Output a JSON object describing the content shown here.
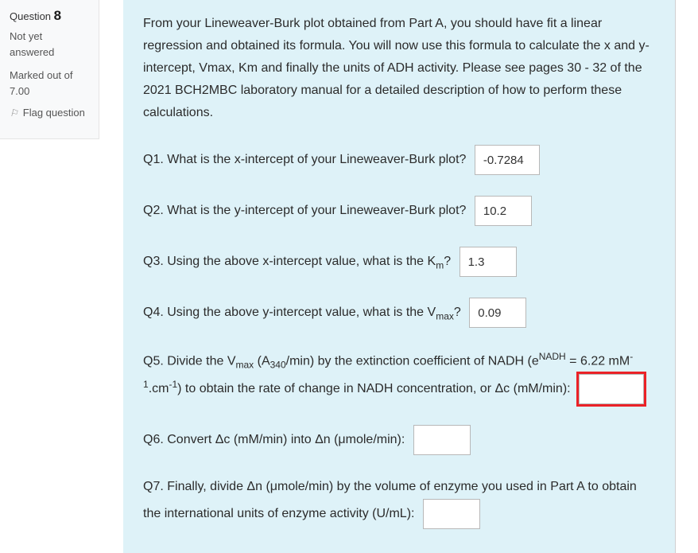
{
  "sidebar": {
    "question_label": "Question",
    "question_number": "8",
    "status": "Not yet answered",
    "marked_prefix": "Marked out of",
    "marked_value": "7.00",
    "flag_label": "Flag question"
  },
  "main": {
    "intro": "From your Lineweaver-Burk plot obtained from Part A, you should have fit a linear regression and obtained its formula. You will now use this formula to calculate the x and y-intercept, Vmax, Km and finally the units of ADH activity. Please see pages 30 - 32 of the 2021 BCH2MBC laboratory manual for a detailed description of how to perform these calculations.",
    "q1": {
      "label": "Q1. What is the x-intercept of your Lineweaver-Burk plot?",
      "value": "-0.7284"
    },
    "q2": {
      "label": "Q2. What is the y-intercept of your Lineweaver-Burk plot?",
      "value": "10.2"
    },
    "q3": {
      "label_before": "Q3. Using the above x-intercept value, what is the K",
      "sub": "m",
      "label_after": "?",
      "value": "1.3"
    },
    "q4": {
      "label_before": "Q4. Using the above y-intercept value, what is the V",
      "sub": "max",
      "label_after": "?",
      "value": "0.09"
    },
    "q5": {
      "p1": "Q5. Divide the V",
      "sub1": "max",
      "p2": " (A",
      "sub2": "340",
      "p3": "/min) by the extinction coefficient of NADH (e",
      "sup1": "NADH",
      "p4": " = 6.22 mM",
      "sup2": "-1",
      "p5": ".cm",
      "sup3": "-1",
      "p6": ") to obtain the rate of change in NADH concentration, or Δc (mM/min):",
      "value": ""
    },
    "q6": {
      "label": "Q6. Convert Δc (mM/min) into Δn (μmole/min):",
      "value": ""
    },
    "q7": {
      "label": "Q7. Finally, divide Δn (μmole/min) by the volume of enzyme you used in Part A to obtain the international units of enzyme activity (U/mL):",
      "value": ""
    }
  }
}
